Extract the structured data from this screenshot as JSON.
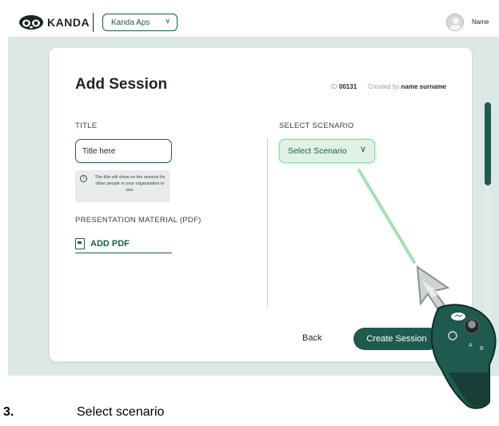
{
  "header": {
    "logo_text": "KANDA",
    "org_select": "Kanda Aps",
    "user_name": "Name"
  },
  "card": {
    "title": "Add Session",
    "id_label": "ID",
    "id_value": "00131",
    "created_label": "Created by",
    "created_value": "name surname",
    "title_label": "TITLE",
    "title_placeholder": "Title here",
    "hint": "The title will show on the session for other people in your organization to see.",
    "material_label": "PRESENTATION MATERIAL (PDF)",
    "add_pdf_label": "ADD PDF",
    "scenario_label": "SELECT SCENARIO",
    "scenario_select": "Select Scenario",
    "back_label": "Back",
    "create_label": "Create Session"
  },
  "scroll": {
    "thumb_fraction": 0.35
  },
  "caption": {
    "number": "3.",
    "text": "Select scenario"
  },
  "colors": {
    "accent": "#1f5a4e",
    "highlight": "#94d4a9",
    "background": "#dbe8e6"
  },
  "icons": [
    "kanda-logo-icon",
    "chevron-down-icon",
    "avatar-icon",
    "info-icon",
    "pdf-icon",
    "vr-pointer-icon",
    "vr-controller-icon"
  ]
}
